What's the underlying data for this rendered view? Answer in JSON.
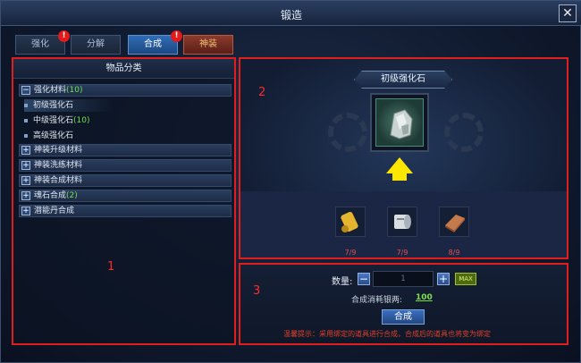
{
  "window": {
    "title": "锻造",
    "close_icon": "close-icon"
  },
  "tabs": [
    {
      "label": "强化",
      "badge": "!"
    },
    {
      "label": "分解",
      "badge": ""
    },
    {
      "label": "合成",
      "badge": "!",
      "active": true
    },
    {
      "label": "神装",
      "badge": ""
    }
  ],
  "categories": {
    "header": "物品分类",
    "groups": [
      {
        "toggle": "−",
        "label": "强化材料",
        "count": "(10)",
        "items": [
          {
            "label": "初级强化石",
            "count": ""
          },
          {
            "label": "中级强化石",
            "count": "(10)"
          },
          {
            "label": "高级强化石",
            "count": ""
          }
        ]
      },
      {
        "toggle": "+",
        "label": "神装升级材料",
        "count": ""
      },
      {
        "toggle": "+",
        "label": "神装洗练材料",
        "count": ""
      },
      {
        "toggle": "+",
        "label": "神装合成材料",
        "count": ""
      },
      {
        "toggle": "+",
        "label": "魂石合成",
        "count": "(2)"
      },
      {
        "toggle": "+",
        "label": "潜能丹合成",
        "count": ""
      }
    ]
  },
  "annotations": [
    "1",
    "2",
    "3"
  ],
  "synthesis": {
    "target_name": "初级强化石",
    "materials": [
      {
        "icon": "scroll-icon",
        "count": "7/9"
      },
      {
        "icon": "paper-roll-icon",
        "count": "7/9"
      },
      {
        "icon": "copper-ingot-icon",
        "count": "8/9"
      }
    ]
  },
  "controls": {
    "qty_label": "数量:",
    "minus": "−",
    "plus": "+",
    "qty_value": "1",
    "max_label": "MAX",
    "cost_label": "合成消耗银两:",
    "cost_value": "100",
    "combine_label": "合成",
    "tip": "温馨提示：采用绑定的道具进行合成，合成后的道具也将变为绑定"
  },
  "colors": {
    "highlight_border": "#e01e1e",
    "accent_green": "#6de04f",
    "arrow_yellow": "#ffe600"
  }
}
